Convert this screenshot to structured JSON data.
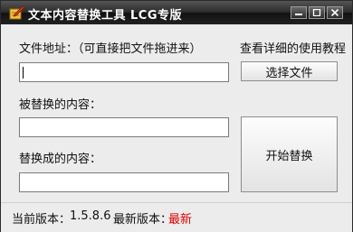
{
  "window": {
    "title": "文本内容替换工具 LCG专版",
    "icon": "pencil-notebook-icon"
  },
  "form": {
    "file_label": "文件地址：（可直接把文件拖进来）",
    "help_link": "查看详细的使用教程",
    "select_button": "选择文件",
    "file_value": "",
    "replace_from_label": "被替换的内容：",
    "replace_from_value": "",
    "replace_to_label": "替换成的内容：",
    "replace_to_value": "",
    "start_button": "开始替换"
  },
  "status": {
    "current_label": "当前版本：",
    "current_version": "1.5.8.6",
    "latest_label": "最新版本：",
    "latest_value": "最新",
    "latest_color": "#e00000"
  }
}
